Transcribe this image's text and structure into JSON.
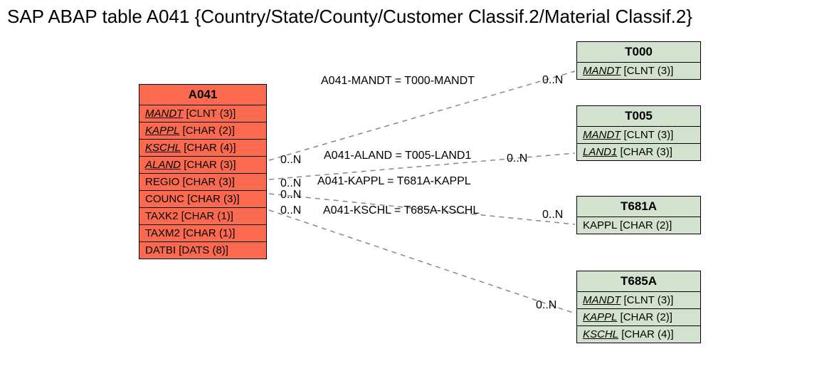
{
  "title": "SAP ABAP table A041 {Country/State/County/Customer Classif.2/Material Classif.2}",
  "main": {
    "name": "A041",
    "fields": [
      {
        "name": "MANDT",
        "type": "[CLNT (3)]",
        "key": true
      },
      {
        "name": "KAPPL",
        "type": "[CHAR (2)]",
        "key": true
      },
      {
        "name": "KSCHL",
        "type": "[CHAR (4)]",
        "key": true
      },
      {
        "name": "ALAND",
        "type": "[CHAR (3)]",
        "key": true
      },
      {
        "name": "REGIO",
        "type": "[CHAR (3)]",
        "key": false
      },
      {
        "name": "COUNC",
        "type": "[CHAR (3)]",
        "key": false
      },
      {
        "name": "TAXK2",
        "type": "[CHAR (1)]",
        "key": false
      },
      {
        "name": "TAXM2",
        "type": "[CHAR (1)]",
        "key": false
      },
      {
        "name": "DATBI",
        "type": "[DATS (8)]",
        "key": false
      }
    ]
  },
  "refs": {
    "t000": {
      "name": "T000",
      "fields": [
        {
          "name": "MANDT",
          "type": "[CLNT (3)]",
          "key": true
        }
      ]
    },
    "t005": {
      "name": "T005",
      "fields": [
        {
          "name": "MANDT",
          "type": "[CLNT (3)]",
          "key": true
        },
        {
          "name": "LAND1",
          "type": "[CHAR (3)]",
          "key": true
        }
      ]
    },
    "t681a": {
      "name": "T681A",
      "fields": [
        {
          "name": "KAPPL",
          "type": "[CHAR (2)]",
          "key": false
        }
      ]
    },
    "t685a": {
      "name": "T685A",
      "fields": [
        {
          "name": "MANDT",
          "type": "[CLNT (3)]",
          "key": true
        },
        {
          "name": "KAPPL",
          "type": "[CHAR (2)]",
          "key": true
        },
        {
          "name": "KSCHL",
          "type": "[CHAR (4)]",
          "key": true
        }
      ]
    }
  },
  "edges": {
    "e1": {
      "label": "A041-MANDT = T000-MANDT",
      "left": "0..N",
      "right": "0..N"
    },
    "e2": {
      "label": "A041-ALAND = T005-LAND1",
      "left": "0..N",
      "right": "0..N"
    },
    "e3": {
      "label": "A041-KAPPL = T681A-KAPPL",
      "left": "0..N",
      "right": "0..N"
    },
    "e4": {
      "label": "A041-KSCHL = T685A-KSCHL",
      "left": "0..N",
      "right": "0..N"
    }
  },
  "chart_data": {
    "type": "table",
    "description": "Entity-relationship diagram for SAP ABAP table A041",
    "main_table": "A041",
    "tables": {
      "A041": [
        "MANDT CLNT(3) PK",
        "KAPPL CHAR(2) PK",
        "KSCHL CHAR(4) PK",
        "ALAND CHAR(3) PK",
        "REGIO CHAR(3)",
        "COUNC CHAR(3)",
        "TAXK2 CHAR(1)",
        "TAXM2 CHAR(1)",
        "DATBI DATS(8)"
      ],
      "T000": [
        "MANDT CLNT(3) PK"
      ],
      "T005": [
        "MANDT CLNT(3) PK",
        "LAND1 CHAR(3) PK"
      ],
      "T681A": [
        "KAPPL CHAR(2)"
      ],
      "T685A": [
        "MANDT CLNT(3) PK",
        "KAPPL CHAR(2) PK",
        "KSCHL CHAR(4) PK"
      ]
    },
    "relationships": [
      {
        "from": "A041.MANDT",
        "to": "T000.MANDT",
        "card_from": "0..N",
        "card_to": "0..N"
      },
      {
        "from": "A041.ALAND",
        "to": "T005.LAND1",
        "card_from": "0..N",
        "card_to": "0..N"
      },
      {
        "from": "A041.KAPPL",
        "to": "T681A.KAPPL",
        "card_from": "0..N",
        "card_to": "0..N"
      },
      {
        "from": "A041.KSCHL",
        "to": "T685A.KSCHL",
        "card_from": "0..N",
        "card_to": "0..N"
      }
    ]
  }
}
